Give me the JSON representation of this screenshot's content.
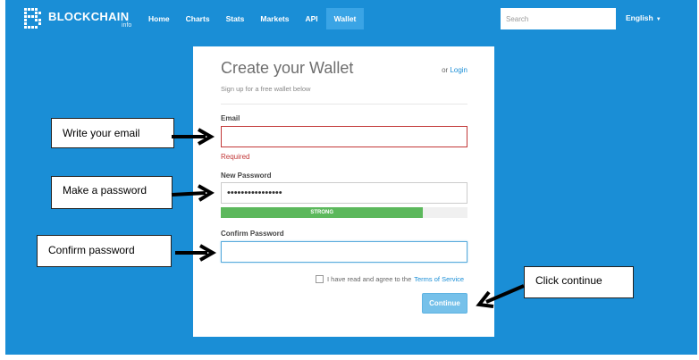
{
  "app": {
    "brand": "BLOCKCHAIN",
    "brand_sub": "info",
    "accent_color": "#1a8ed6"
  },
  "nav": {
    "items": [
      {
        "label": "Home"
      },
      {
        "label": "Charts"
      },
      {
        "label": "Stats"
      },
      {
        "label": "Markets"
      },
      {
        "label": "API"
      },
      {
        "label": "Wallet",
        "active": true
      }
    ],
    "search_placeholder": "Search",
    "language": "English",
    "language_icon": "caret-down-icon"
  },
  "form": {
    "title": "Create your Wallet",
    "subtitle": "Sign up for a free wallet below",
    "login_prefix": "or",
    "login_link": "Login",
    "email_label": "Email",
    "email_value": "",
    "email_error": "Required",
    "password_label": "New Password",
    "password_value": "••••••••••••••••",
    "strength_label": "STRONG",
    "strength_fraction": 0.82,
    "strength_color": "#5cb85c",
    "confirm_label": "Confirm Password",
    "confirm_value": "",
    "terms_text": "I have read and agree to the",
    "terms_link": "Terms of Service",
    "terms_checked": false,
    "continue_label": "Continue"
  },
  "annotations": {
    "email": "Write your email",
    "password": "Make a  password",
    "confirm": "Confirm password",
    "continue": "Click continue"
  }
}
